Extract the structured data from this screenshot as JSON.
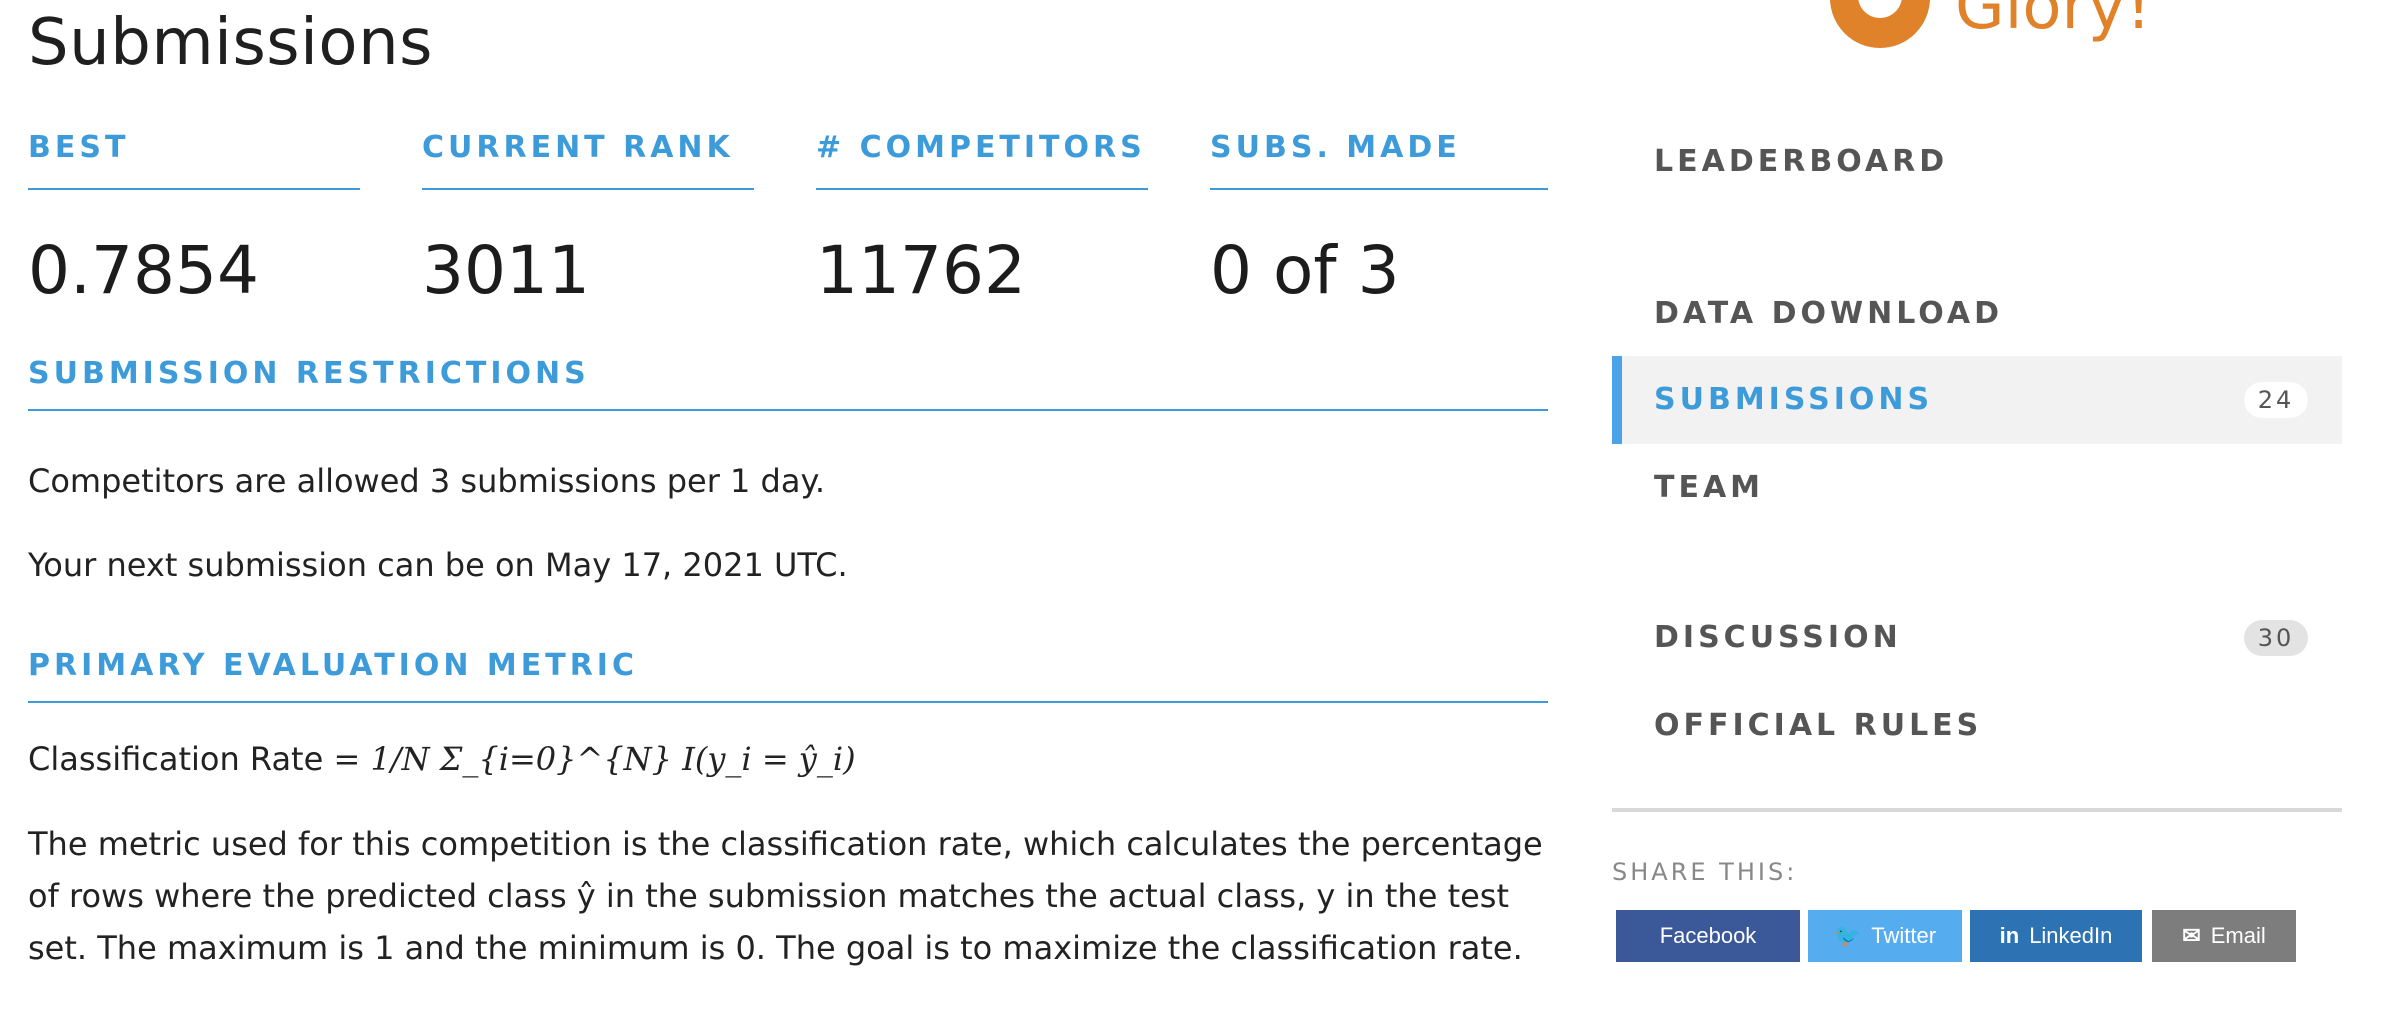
{
  "page_title": "Submissions",
  "stats": [
    {
      "label": "BEST",
      "value": "0.7854"
    },
    {
      "label": "CURRENT RANK",
      "value": "3011"
    },
    {
      "label": "# COMPETITORS",
      "value": "11762"
    },
    {
      "label": "SUBS. MADE",
      "value": "0 of 3"
    }
  ],
  "restrictions": {
    "title": "SUBMISSION RESTRICTIONS",
    "line1": "Competitors are allowed 3 submissions per 1 day.",
    "line2": "Your next submission can be on May 17, 2021 UTC."
  },
  "metric": {
    "title": "PRIMARY EVALUATION METRIC",
    "formula_label": "Classification Rate",
    "formula": "= 1/N Σ_{i=0}^{N} I(y_i = ŷ_i)",
    "description": "The metric used for this competition is the classification rate, which calculates the percentage of rows where the predicted class ŷ in the submission matches the actual class, y in the test set. The maximum is 1 and the minimum is 0. The goal is to maximize the classification rate."
  },
  "sidebar": {
    "brand_text": "Glory!",
    "items": [
      {
        "label": "LEADERBOARD",
        "badge": ""
      },
      {
        "label": "DATA DOWNLOAD",
        "badge": ""
      },
      {
        "label": "SUBMISSIONS",
        "badge": "24",
        "active": true
      },
      {
        "label": "TEAM",
        "badge": ""
      },
      {
        "label": "DISCUSSION",
        "badge": "30"
      },
      {
        "label": "OFFICIAL RULES",
        "badge": ""
      }
    ],
    "share_label": "SHARE THIS:",
    "share_buttons": [
      {
        "label": "Facebook",
        "color": "#3b5998"
      },
      {
        "label": "Twitter",
        "color": "#55acee"
      },
      {
        "label": "LinkedIn",
        "color": "#2d73b4"
      },
      {
        "label": "Email",
        "color": "#7d7d7d"
      }
    ]
  },
  "colors": {
    "accent": "#3d9bd9",
    "brand": "#e0822a"
  }
}
